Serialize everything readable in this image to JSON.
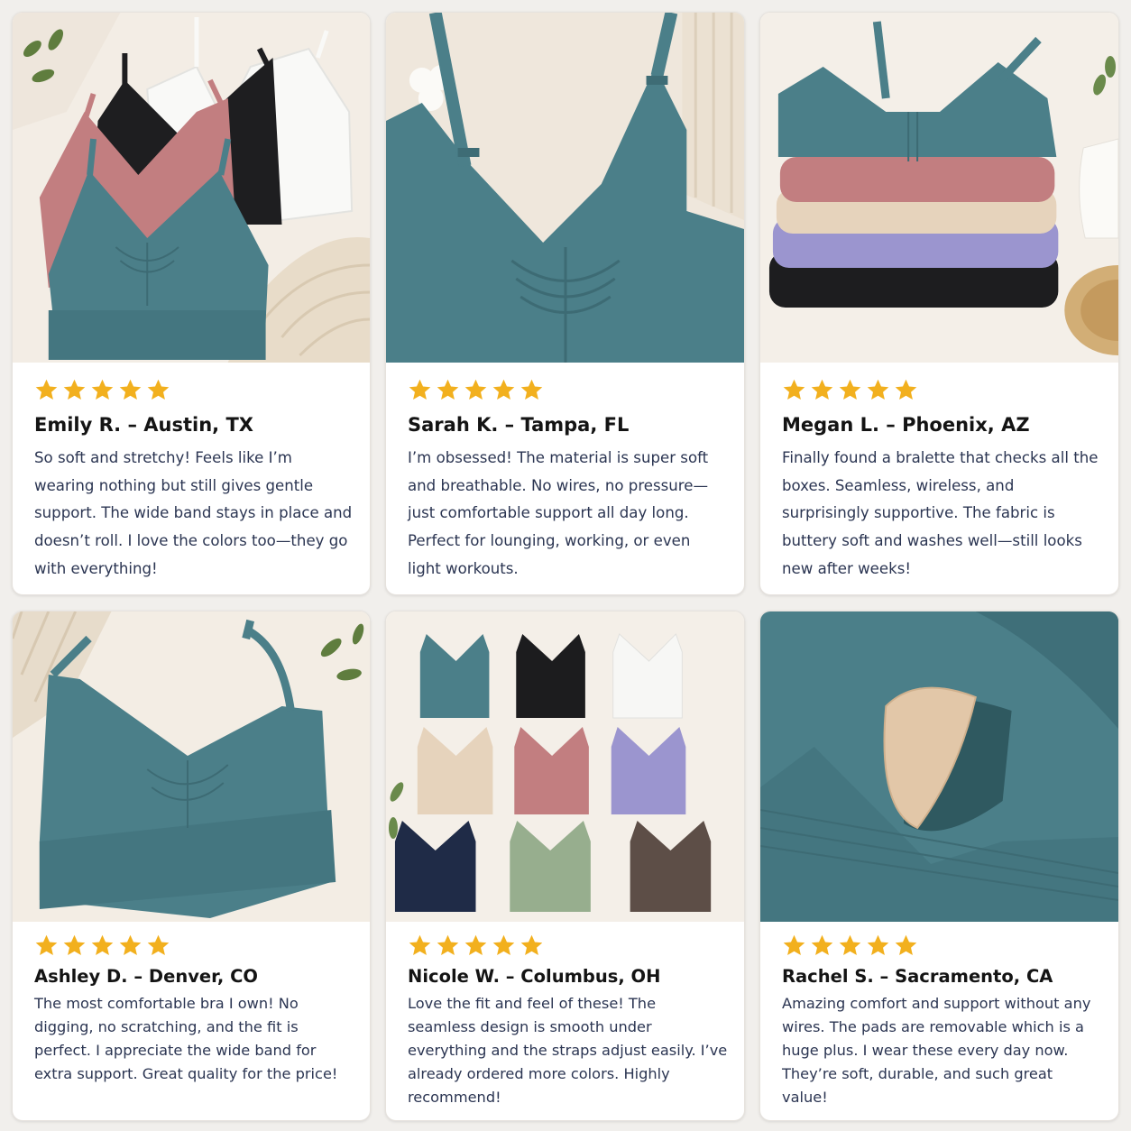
{
  "reviews": [
    {
      "rating": 5,
      "reviewer": "Emily R. – Austin, TX",
      "text": "So soft and stretchy! Feels like I’m wearing nothing but still gives gentle support. The wide band stays in place and doesn’t roll. I love the colors too—they go with everything!"
    },
    {
      "rating": 5,
      "reviewer": "Sarah K. – Tampa, FL",
      "text": "I’m obsessed! The material is super soft and breathable. No wires, no pressure—just comfortable support all day long. Perfect for lounging, working, or even light workouts."
    },
    {
      "rating": 5,
      "reviewer": "Megan L. – Phoenix, AZ",
      "text": "Finally found a bralette that checks all the boxes. Seamless, wireless, and surprisingly supportive. The fabric is buttery soft and washes well—still looks new after weeks!"
    },
    {
      "rating": 5,
      "reviewer": "Ashley D. – Denver, CO",
      "text": "The most comfortable bra I own! No digging, no scratching, and the fit is perfect. I appreciate the wide band for extra support. Great quality for the price!"
    },
    {
      "rating": 5,
      "reviewer": "Nicole W. – Columbus, OH",
      "text": "Love the fit and feel of these! The seamless design is smooth under everything and the straps adjust easily. I’ve already ordered more colors. Highly recommend!"
    },
    {
      "rating": 5,
      "reviewer": "Rachel S. – Sacramento, CA",
      "text": "Amazing comfort and support without any wires. The pads are removable which is a huge plus. I wear these every day now. They’re soft, durable, and such great value!"
    }
  ],
  "colors": {
    "star": "#f2b01e",
    "teal": "#4b7f89",
    "black": "#1c1c1e",
    "white": "#f7f7f5",
    "rose": "#c27e80",
    "beige": "#e6d3bc",
    "lavender": "#9b95cf",
    "navy": "#1f2b47",
    "sage": "#97ae8e",
    "brown": "#5d4e47",
    "pad": "#e2c7a8"
  }
}
